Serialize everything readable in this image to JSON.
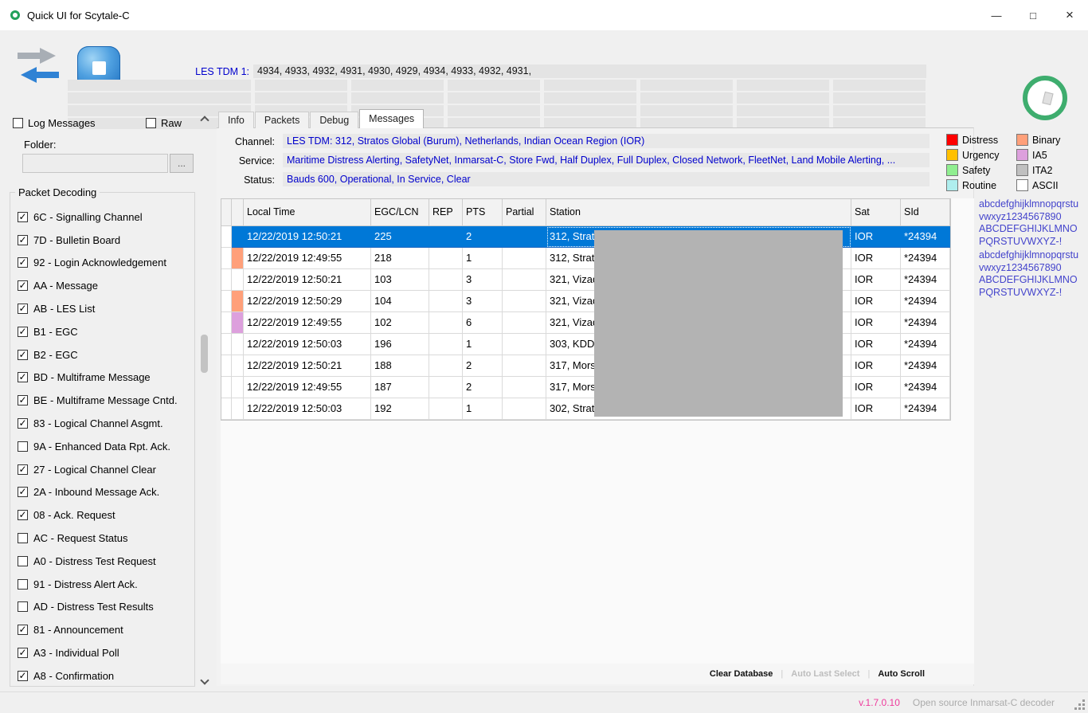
{
  "titlebar": {
    "title": "Quick UI for Scytale-C",
    "minimize_icon": "—",
    "maximize_icon": "□",
    "close_icon": "×"
  },
  "toolbar": {
    "les_tdm_label": "LES TDM 1:",
    "les_tdm_value": "4934, 4933, 4932, 4931, 4930, 4929, 4934, 4933, 4932, 4931,",
    "empty_rows": 4,
    "empty_cols": 7
  },
  "left_panel": {
    "log_messages": {
      "label": "Log Messages",
      "checked": false
    },
    "raw": {
      "label": "Raw",
      "checked": false
    },
    "folder_label": "Folder:",
    "folder_value": "",
    "browse_button": "...",
    "group_title": "Packet Decoding",
    "packet_types": [
      {
        "label": "6C - Signalling Channel",
        "checked": true
      },
      {
        "label": "7D - Bulletin Board",
        "checked": true
      },
      {
        "label": "92 - Login Acknowledgement",
        "checked": true
      },
      {
        "label": "AA - Message",
        "checked": true
      },
      {
        "label": "AB - LES List",
        "checked": true
      },
      {
        "label": "B1 - EGC",
        "checked": true
      },
      {
        "label": "B2 - EGC",
        "checked": true
      },
      {
        "label": "BD - Multiframe Message",
        "checked": true
      },
      {
        "label": "BE - Multiframe Message Cntd.",
        "checked": true
      },
      {
        "label": "83 - Logical Channel Asgmt.",
        "checked": true
      },
      {
        "label": "9A - Enhanced Data Rpt. Ack.",
        "checked": false
      },
      {
        "label": "27 - Logical Channel Clear",
        "checked": true
      },
      {
        "label": "2A - Inbound Message Ack.",
        "checked": true
      },
      {
        "label": "08 - Ack. Request",
        "checked": true
      },
      {
        "label": "AC - Request Status",
        "checked": false
      },
      {
        "label": "A0 - Distress Test Request",
        "checked": false
      },
      {
        "label": "91 - Distress Alert Ack.",
        "checked": false
      },
      {
        "label": "AD - Distress Test Results",
        "checked": false
      },
      {
        "label": "81 - Announcement",
        "checked": true
      },
      {
        "label": "A3 - Individual Poll",
        "checked": true
      },
      {
        "label": "A8 - Confirmation",
        "checked": true
      }
    ]
  },
  "tabs": [
    {
      "label": "Info",
      "active": false
    },
    {
      "label": "Packets",
      "active": false
    },
    {
      "label": "Debug",
      "active": false
    },
    {
      "label": "Messages",
      "active": true
    }
  ],
  "channel_info": {
    "channel_label": "Channel:",
    "channel_value": "LES TDM: 312, Stratos Global (Burum), Netherlands, Indian Ocean Region (IOR)",
    "service_label": "Service:",
    "service_value": "Maritime Distress Alerting, SafetyNet, Inmarsat-C, Store Fwd, Half Duplex, Full Duplex, Closed Network, FleetNet, Land Mobile Alerting, ...",
    "status_label": "Status:",
    "status_value": "Bauds 600, Operational, In Service, Clear"
  },
  "legend": [
    {
      "label": "Distress",
      "color": "#ff0000"
    },
    {
      "label": "Urgency",
      "color": "#ffc000"
    },
    {
      "label": "Safety",
      "color": "#90ee90"
    },
    {
      "label": "Routine",
      "color": "#afeeee"
    },
    {
      "label": "Binary",
      "color": "#ffa07a"
    },
    {
      "label": "IA5",
      "color": "#dda0dd"
    },
    {
      "label": "ITA2",
      "color": "#c0c0c0"
    },
    {
      "label": "ASCII",
      "color": "#ffffff"
    }
  ],
  "table": {
    "columns": [
      "",
      "",
      "Local Time",
      "EGC/LCN",
      "REP",
      "PTS",
      "Partial",
      "Station",
      "Sat",
      "SId"
    ],
    "rows": [
      {
        "marker": "",
        "selected": true,
        "local_time": "12/22/2019 12:50:21",
        "egc_lcn": "225",
        "rep": "",
        "pts": "2",
        "partial": "",
        "station": "312, Stratos G",
        "sat": "IOR",
        "sid": "*24394"
      },
      {
        "marker": "#ffa07a",
        "selected": false,
        "local_time": "12/22/2019 12:49:55",
        "egc_lcn": "218",
        "rep": "",
        "pts": "1",
        "partial": "",
        "station": "312, Stratos G",
        "sat": "IOR",
        "sid": "*24394"
      },
      {
        "marker": "",
        "selected": false,
        "local_time": "12/22/2019 12:50:21",
        "egc_lcn": "103",
        "rep": "",
        "pts": "3",
        "partial": "",
        "station": "321, Vizada (",
        "sat": "IOR",
        "sid": "*24394"
      },
      {
        "marker": "#ffa07a",
        "selected": false,
        "local_time": "12/22/2019 12:50:29",
        "egc_lcn": "104",
        "rep": "",
        "pts": "3",
        "partial": "",
        "station": "321, Vizada (",
        "sat": "IOR",
        "sid": "*24394"
      },
      {
        "marker": "#dda0dd",
        "selected": false,
        "local_time": "12/22/2019 12:49:55",
        "egc_lcn": "102",
        "rep": "",
        "pts": "6",
        "partial": "",
        "station": "321, Vizada (",
        "sat": "IOR",
        "sid": "*24394"
      },
      {
        "marker": "",
        "selected": false,
        "local_time": "12/22/2019 12:50:03",
        "egc_lcn": "196",
        "rep": "",
        "pts": "1",
        "partial": "",
        "station": "303, KDDI Ja",
        "sat": "IOR",
        "sid": "*24394"
      },
      {
        "marker": "",
        "selected": false,
        "local_time": "12/22/2019 12:50:21",
        "egc_lcn": "188",
        "rep": "",
        "pts": "2",
        "partial": "",
        "station": "317, Morsviaz",
        "sat": "IOR",
        "sid": "*24394"
      },
      {
        "marker": "",
        "selected": false,
        "local_time": "12/22/2019 12:49:55",
        "egc_lcn": "187",
        "rep": "",
        "pts": "2",
        "partial": "",
        "station": "317, Morsviaz",
        "sat": "IOR",
        "sid": "*24394"
      },
      {
        "marker": "",
        "selected": false,
        "local_time": "12/22/2019 12:50:03",
        "egc_lcn": "192",
        "rep": "",
        "pts": "1",
        "partial": "",
        "station": "302, Stratos G",
        "sat": "IOR",
        "sid": "*24394"
      }
    ]
  },
  "grid_footer": {
    "clear_database": "Clear Database",
    "auto_last_select": "Auto Last Select",
    "auto_scroll": "Auto Scroll",
    "separator": "|"
  },
  "right_panel": {
    "text_color": "#4444cc",
    "blocks": [
      "abcdefghijklmnopqrstuvwxyz1234567890\nABCDEFGHIJKLMNOPQRSTUVWXYZ-!",
      "abcdefghijklmnopqrstuvwxyz1234567890\nABCDEFGHIJKLMNOPQRSTUVWXYZ-!"
    ]
  },
  "statusbar": {
    "version": "v.1.7.0.10",
    "description": "Open source Inmarsat-C decoder"
  }
}
